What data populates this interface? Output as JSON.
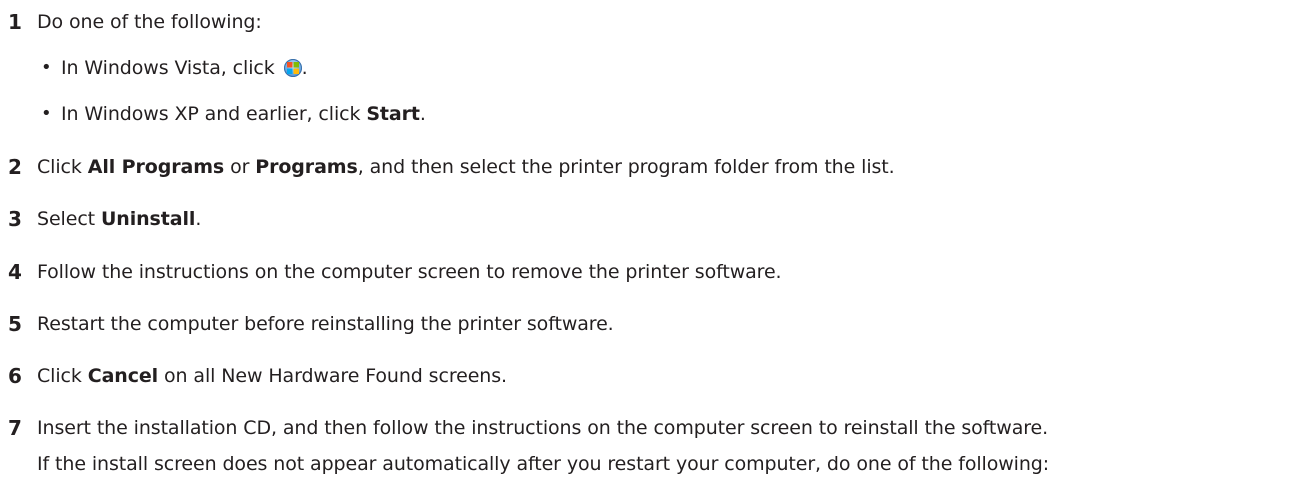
{
  "steps": [
    {
      "num": "1",
      "text": "Do one of the following:"
    },
    {
      "num": "2",
      "pre": "Click ",
      "b1": "All Programs",
      "mid": " or ",
      "b2": "Programs",
      "post": ", and then select the printer program folder from the list."
    },
    {
      "num": "3",
      "pre": "Select ",
      "b1": "Uninstall",
      "post": "."
    },
    {
      "num": "4",
      "text": "Follow the instructions on the computer screen to remove the printer software."
    },
    {
      "num": "5",
      "text": "Restart the computer before reinstalling the printer software."
    },
    {
      "num": "6",
      "pre": "Click ",
      "b1": "Cancel",
      "post": " on all New Hardware Found screens."
    },
    {
      "num": "7",
      "text": "Insert the installation CD, and then follow the instructions on the computer screen to reinstall the software."
    }
  ],
  "bullets": [
    {
      "pre": "In Windows Vista, click ",
      "icon": "windows-vista-start-orb-icon",
      "post": "."
    },
    {
      "pre": "In Windows XP and earlier, click ",
      "b1": "Start",
      "post": "."
    }
  ],
  "note": "If the install screen does not appear automatically after you restart your computer, do one of the following:",
  "bullet_glyph": "•"
}
